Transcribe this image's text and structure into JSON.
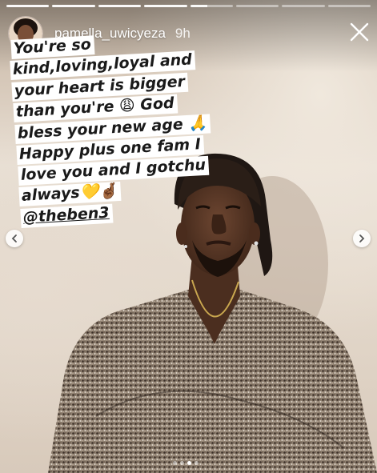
{
  "story": {
    "username": "pamella_uwicyeza",
    "timestamp": "9h",
    "progress_segments": [
      {
        "state": "done"
      },
      {
        "state": "done"
      },
      {
        "state": "done"
      },
      {
        "state": "done"
      },
      {
        "state": "active",
        "fill": 0.4
      },
      {
        "state": "pending"
      },
      {
        "state": "pending"
      },
      {
        "state": "pending"
      }
    ],
    "close_icon": "close-icon",
    "prev_icon": "chevron-left-icon",
    "next_icon": "chevron-right-icon"
  },
  "caption": {
    "lines": [
      "You're so",
      "kind,loving,loyal and",
      "your heart is bigger",
      "than you're 😩 God",
      "bless your new age 🙏",
      "Happy plus one fam I",
      "love you and I gotchu",
      "always💛🤞🏾"
    ],
    "mention": "@theben3"
  },
  "pagination": {
    "count": 4,
    "active_index": 2
  },
  "colors": {
    "caption_bg": "#ffffff",
    "caption_text": "#1a1a1a",
    "sweater": "#8a7a6c",
    "skin": "#5a3a28"
  }
}
